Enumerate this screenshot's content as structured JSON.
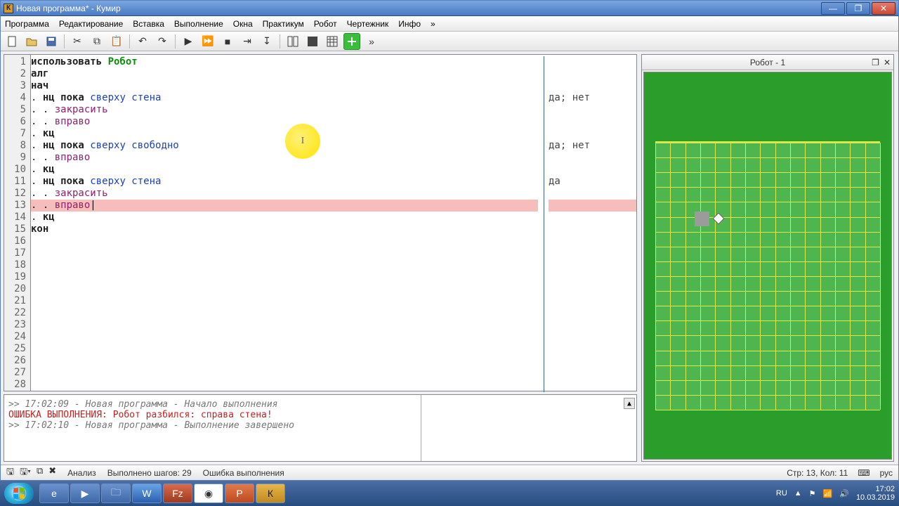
{
  "window": {
    "title": "Новая программа* - Кумир",
    "minimize": "—",
    "maximize": "❐",
    "close": "✕"
  },
  "menu": [
    "Программа",
    "Редактирование",
    "Вставка",
    "Выполнение",
    "Окна",
    "Практикум",
    "Робот",
    "Чертежник",
    "Инфо",
    "»"
  ],
  "code": {
    "line_count": 28,
    "highlight_line": 13,
    "lines": [
      {
        "n": 1,
        "tokens": [
          [
            "kw",
            "использовать "
          ],
          [
            "rob",
            "Робот"
          ]
        ]
      },
      {
        "n": 2,
        "tokens": [
          [
            "kw",
            "алг"
          ]
        ]
      },
      {
        "n": 3,
        "tokens": [
          [
            "kw",
            "нач"
          ]
        ]
      },
      {
        "n": 4,
        "tokens": [
          [
            "dot",
            ". "
          ],
          [
            "kw",
            "нц пока "
          ],
          [
            "cond",
            "сверху стена"
          ]
        ],
        "note": "да; нет"
      },
      {
        "n": 5,
        "tokens": [
          [
            "dot",
            ". . "
          ],
          [
            "act",
            "закрасить"
          ]
        ]
      },
      {
        "n": 6,
        "tokens": [
          [
            "dot",
            ". . "
          ],
          [
            "act",
            "вправо"
          ]
        ]
      },
      {
        "n": 7,
        "tokens": [
          [
            "dot",
            ". "
          ],
          [
            "kw",
            "кц"
          ]
        ]
      },
      {
        "n": 8,
        "tokens": [
          [
            "dot",
            ". "
          ],
          [
            "kw",
            "нц пока "
          ],
          [
            "cond",
            "сверху свободно"
          ]
        ],
        "note": "да; нет"
      },
      {
        "n": 9,
        "tokens": [
          [
            "dot",
            ". . "
          ],
          [
            "act",
            "вправо"
          ]
        ]
      },
      {
        "n": 10,
        "tokens": [
          [
            "dot",
            ". "
          ],
          [
            "kw",
            "кц"
          ]
        ]
      },
      {
        "n": 11,
        "tokens": [
          [
            "dot",
            ". "
          ],
          [
            "kw",
            "нц пока "
          ],
          [
            "cond",
            "сверху стена"
          ]
        ],
        "note": "да"
      },
      {
        "n": 12,
        "tokens": [
          [
            "dot",
            ". . "
          ],
          [
            "act",
            "закрасить"
          ]
        ]
      },
      {
        "n": 13,
        "tokens": [
          [
            "dot",
            ". . "
          ],
          [
            "act",
            "вправо"
          ]
        ]
      },
      {
        "n": 14,
        "tokens": [
          [
            "dot",
            ". "
          ],
          [
            "kw",
            "кц"
          ]
        ]
      },
      {
        "n": 15,
        "tokens": [
          [
            "kw",
            "кон"
          ]
        ]
      }
    ]
  },
  "output": {
    "line1": ">> 17:02:09 - Новая программа - Начало выполнения",
    "error": "ОШИБКА ВЫПОЛНЕНИЯ: Робот разбился: справа стена!",
    "line3": ">> 17:02:10 - Новая программа - Выполнение завершено"
  },
  "robot_panel": {
    "title": "Робот - 1",
    "restore": "❐",
    "close": "✕"
  },
  "status": {
    "analysis": "Анализ",
    "steps": "Выполнено шагов: 29",
    "runmsg": "Ошибка выполнения",
    "cursor": "Стр: 13, Кол: 11",
    "lang_ind": "рус"
  },
  "taskbar": {
    "lang": "RU",
    "time": "17:02",
    "date": "10.03.2019"
  }
}
